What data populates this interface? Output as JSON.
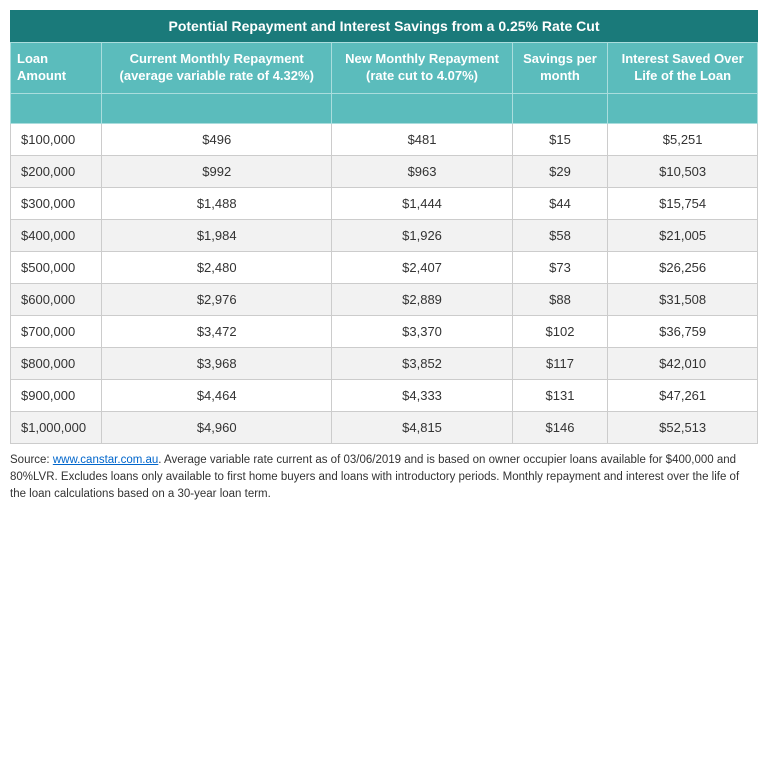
{
  "title": "Potential Repayment and Interest Savings from a 0.25% Rate Cut",
  "columns": [
    "Loan Amount",
    "Current Monthly Repayment (average variable rate of 4.32%)",
    "New Monthly Repayment (rate cut to 4.07%)",
    "Savings per month",
    "Interest Saved Over Life of the Loan"
  ],
  "rows": [
    {
      "loan": "$100,000",
      "current": "$496",
      "new": "$481",
      "savings": "$15",
      "interest": "$5,251"
    },
    {
      "loan": "$200,000",
      "current": "$992",
      "new": "$963",
      "savings": "$29",
      "interest": "$10,503"
    },
    {
      "loan": "$300,000",
      "current": "$1,488",
      "new": "$1,444",
      "savings": "$44",
      "interest": "$15,754"
    },
    {
      "loan": "$400,000",
      "current": "$1,984",
      "new": "$1,926",
      "savings": "$58",
      "interest": "$21,005"
    },
    {
      "loan": "$500,000",
      "current": "$2,480",
      "new": "$2,407",
      "savings": "$73",
      "interest": "$26,256"
    },
    {
      "loan": "$600,000",
      "current": "$2,976",
      "new": "$2,889",
      "savings": "$88",
      "interest": "$31,508"
    },
    {
      "loan": "$700,000",
      "current": "$3,472",
      "new": "$3,370",
      "savings": "$102",
      "interest": "$36,759"
    },
    {
      "loan": "$800,000",
      "current": "$3,968",
      "new": "$3,852",
      "savings": "$117",
      "interest": "$42,010"
    },
    {
      "loan": "$900,000",
      "current": "$4,464",
      "new": "$4,333",
      "savings": "$131",
      "interest": "$47,261"
    },
    {
      "loan": "$1,000,000",
      "current": "$4,960",
      "new": "$4,815",
      "savings": "$146",
      "interest": "$52,513"
    }
  ],
  "footnote": {
    "source_label": "Source: ",
    "source_url": "www.canstar.com.au",
    "source_href": "https://www.canstar.com.au",
    "text": ". Average variable rate current as of 03/06/2019 and is based on owner occupier loans available for $400,000 and 80%LVR. Excludes loans only available to first home buyers and loans with introductory periods. Monthly repayment and interest over the life of the loan calculations based on a 30-year loan term."
  }
}
